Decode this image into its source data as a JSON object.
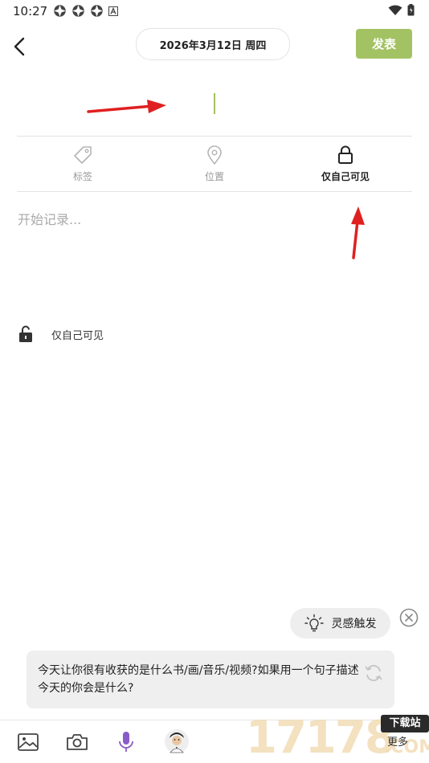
{
  "status_bar": {
    "time": "10:27",
    "left_icons": [
      "sync-icon",
      "sync-icon",
      "sync-icon",
      "a-badge-icon"
    ],
    "right_icons": [
      "wifi-icon",
      "battery-icon"
    ]
  },
  "header": {
    "date": "2026年3月12日 周四",
    "publish_label": "发表"
  },
  "options": [
    {
      "label": "标签",
      "icon": "tag-icon",
      "active": false
    },
    {
      "label": "位置",
      "icon": "location-icon",
      "active": false
    },
    {
      "label": "仅自己可见",
      "icon": "lock-icon",
      "active": true
    }
  ],
  "editor": {
    "content_placeholder": "开始记录..."
  },
  "privacy": {
    "label": "仅自己可见",
    "icon": "unlock-icon"
  },
  "inspiration": {
    "label": "灵感触发",
    "prompt": "今天让你很有收获的是什么书/画/音乐/视频?如果用一个句子描述今天的你会是什么?"
  },
  "toolbar": {
    "items": [
      "image-icon",
      "camera-icon",
      "microphone-icon",
      "avatar-sticker-icon"
    ],
    "more_label": "更多"
  },
  "watermark": {
    "number": "17178",
    "badge": "下载站",
    "domain": ".COM"
  },
  "colors": {
    "accent": "#a3c263",
    "annotation_arrow": "#e02020",
    "mic": "#8a5cc9"
  }
}
